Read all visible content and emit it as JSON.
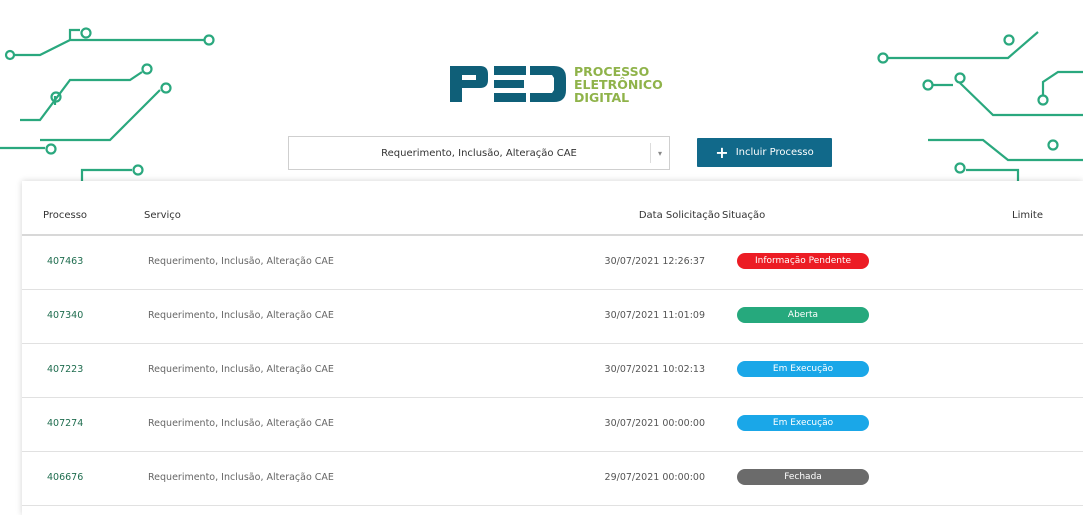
{
  "logo": {
    "mark": "PED",
    "line1": "PROCESSO",
    "line2": "ELETRÔNICO",
    "line3": "DIGITAL",
    "colors": {
      "mark": "#0f5f78",
      "text": "#8fb34a"
    }
  },
  "filter": {
    "service_value": "Requerimento, Inclusão, Alteração CAE",
    "dropdown_arrow": "▾"
  },
  "toolbar": {
    "add_label": "Incluir Processo",
    "add_icon": "+",
    "add_color": "#11698a"
  },
  "table": {
    "headers": {
      "processo": "Processo",
      "servico": "Serviço",
      "data": "Data Solicitação",
      "situacao": "Situação",
      "limite": "Limite"
    },
    "rows": [
      {
        "processo": "407463",
        "servico": "Requerimento, Inclusão, Alteração CAE",
        "data": "30/07/2021 12:26:37",
        "situacao": "Informação Pendente",
        "color": "#ec1c24"
      },
      {
        "processo": "407340",
        "servico": "Requerimento, Inclusão, Alteração CAE",
        "data": "30/07/2021 11:01:09",
        "situacao": "Aberta",
        "color": "#26a97d"
      },
      {
        "processo": "407223",
        "servico": "Requerimento, Inclusão, Alteração CAE",
        "data": "30/07/2021 10:02:13",
        "situacao": "Em Execução",
        "color": "#1aa7e8"
      },
      {
        "processo": "407274",
        "servico": "Requerimento, Inclusão, Alteração CAE",
        "data": "30/07/2021 00:00:00",
        "situacao": "Em Execução",
        "color": "#1aa7e8"
      },
      {
        "processo": "406676",
        "servico": "Requerimento, Inclusão, Alteração CAE",
        "data": "29/07/2021 00:00:00",
        "situacao": "Fechada",
        "color": "#6b6b6b"
      }
    ]
  }
}
